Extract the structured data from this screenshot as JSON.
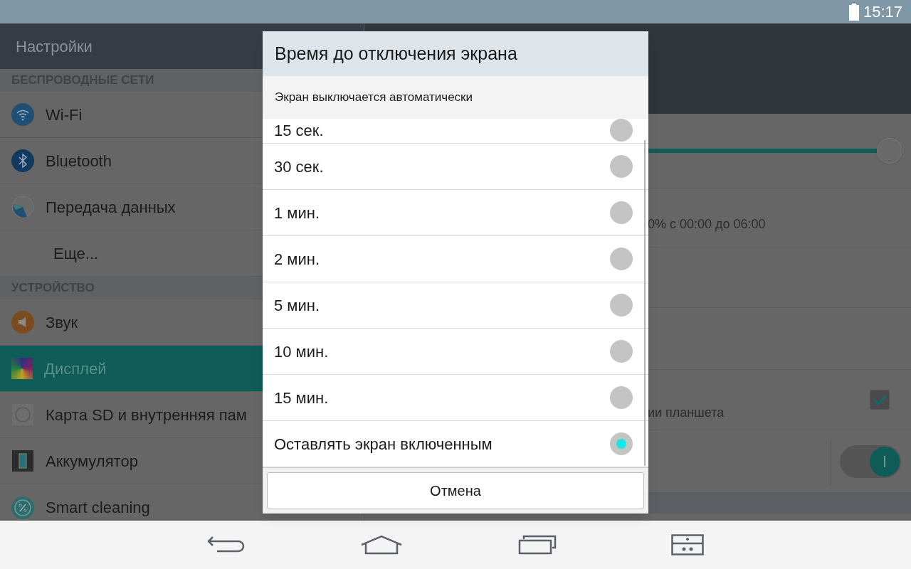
{
  "status_bar": {
    "time": "15:17"
  },
  "app_bar": {
    "title": "Настройки"
  },
  "sidebar": {
    "sections": [
      {
        "header": "БЕСПРОВОДНЫЕ СЕТИ",
        "items": [
          {
            "label": "Wi-Fi",
            "selected": false
          },
          {
            "label": "Bluetooth",
            "selected": false
          },
          {
            "label": "Передача данных",
            "selected": false
          },
          {
            "label": "Еще...",
            "selected": false
          }
        ]
      },
      {
        "header": "УСТРОЙСТВО",
        "items": [
          {
            "label": "Звук",
            "selected": false
          },
          {
            "label": "Дисплей",
            "selected": true
          },
          {
            "label": "Карта SD и внутренняя пам",
            "selected": false
          },
          {
            "label": "Аккумулятор",
            "selected": false
          },
          {
            "label": "Smart cleaning",
            "selected": false
          }
        ]
      }
    ]
  },
  "settings_panel": {
    "slider": {
      "level": 0.98
    },
    "schedule_text": "0% с 00:00 до 06:00",
    "checkbox_row": {
      "text": "ии планшета",
      "checked": true
    },
    "switch_row": {
      "on": true
    }
  },
  "dialog": {
    "title": "Время до отключения экрана",
    "subtitle": "Экран выключается автоматически",
    "options": [
      {
        "label": "15 сек.",
        "selected": false
      },
      {
        "label": "30 сек.",
        "selected": false
      },
      {
        "label": "1 мин.",
        "selected": false
      },
      {
        "label": "2 мин.",
        "selected": false
      },
      {
        "label": "5 мин.",
        "selected": false
      },
      {
        "label": "10 мин.",
        "selected": false
      },
      {
        "label": "15 мин.",
        "selected": false
      },
      {
        "label": "Оставлять экран включенным",
        "selected": true
      }
    ],
    "cancel_button": "Отмена"
  }
}
